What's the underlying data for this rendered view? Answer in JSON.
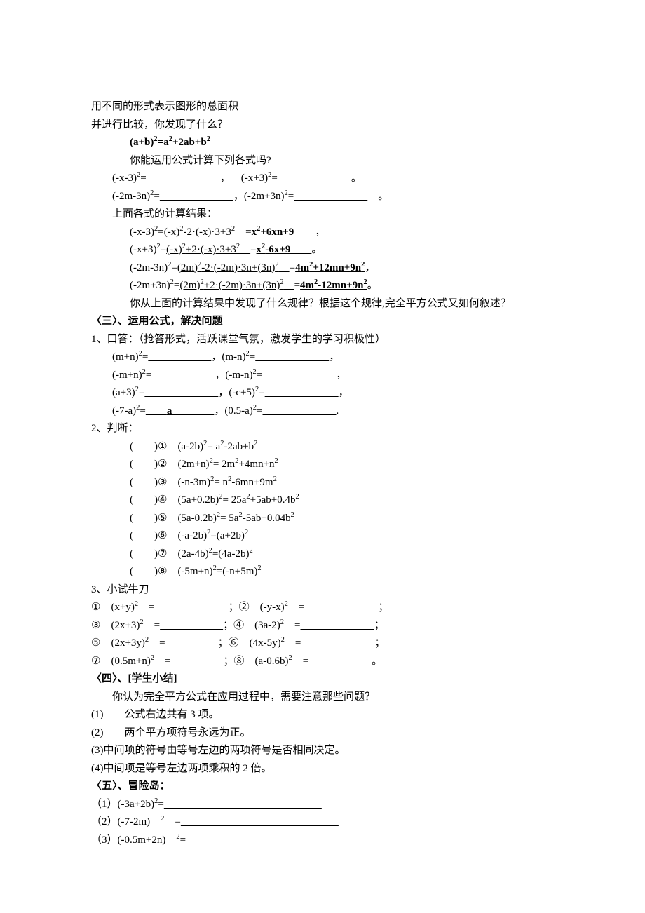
{
  "lines": [
    {
      "cls": "indent1",
      "html": "用不同的形式表示图形的总面积"
    },
    {
      "cls": "indent1",
      "html": "并进行比较，你发现了什么？"
    },
    {
      "cls": "indent2 bold",
      "html": "(a+b)<sup>2</sup>=a<sup>2</sup>+2ab+b<sup>2</sup>"
    },
    {
      "cls": "indent2",
      "html": "你能运用公式计算下列各式吗?"
    },
    {
      "cls": "indent3",
      "html": "(-x-3)<sup>2</sup>=<u>       </u>， (-x+3)<sup>2</sup>=<u>       </u>。"
    },
    {
      "cls": "indent3",
      "html": "(-2m-3n)<sup>2</sup>=<u>       </u>，(-2m+3n)<sup>2</sup>=<u>       </u> 。"
    },
    {
      "cls": "indent3",
      "html": "上面各式的计算结果："
    },
    {
      "cls": "indent2",
      "html": "(-x-3)<sup>2</sup>=<u>(-x)<sup>2</sup>-2·(-x)·3+3<sup>2</sup> </u>=<u class=\"bold\">x<sup>2</sup>+6xn+9  </u>，"
    },
    {
      "cls": "indent2",
      "html": "(-x+3)<sup>2</sup>=<u>(-x)<sup>2</sup>+2·(-x)·3+3<sup>2</sup> </u>=<u class=\"bold\">x<sup>2</sup>-6x+9  </u>。"
    },
    {
      "cls": "indent2",
      "html": "(-2m-3n)<sup>2</sup>=<u>(2m)<sup>2</sup>-2·(-2m)·3n+(3n)<sup>2</sup> </u>=<u class=\"bold\">4m<sup>2</sup>+12mn+9n<sup>2</sup></u>，"
    },
    {
      "cls": "indent2",
      "html": "(-2m+3n)<sup>2</sup>=<u>(2m)<sup>2</sup>+2·(-2m)·3n+(3n)<sup>2</sup> </u>=<u class=\"bold\">4m<sup>2</sup>-12mn+9n<sup>2</sup></u>。"
    },
    {
      "cls": "indent2",
      "html": "你从上面的计算结果中发现了什么规律？根据这个规律,完全平方公式又如何叙述？"
    },
    {
      "cls": "indent1 bold",
      "html": "〈三〉、运用公式，解决问题"
    },
    {
      "cls": "indent1",
      "html": "1、口答：（抢答形式，活跃课堂气氛，激发学生的学习积极性）"
    },
    {
      "cls": "indent3",
      "html": "(m+n)<sup>2</sup>=<u>      </u>，(m-n)<sup>2</sup>=<u>       </u>，"
    },
    {
      "cls": "indent3",
      "html": "(-m+n)<sup>2</sup>=<u>      </u>，(-m-n)<sup>2</sup>=<u>       </u>，"
    },
    {
      "cls": "indent3",
      "html": "(a+3)<sup>2</sup>=<u>       </u>，(-c+5)<sup>2</sup>=<u>       </u>，"
    },
    {
      "cls": "indent3",
      "html": "(-7-a)<sup>2</sup>=<u>  <span class=\"bold\">a</span>    </u>，(0.5-a)<sup>2</sup>=<u>       </u>."
    },
    {
      "cls": "indent1",
      "html": "2、判断："
    },
    {
      "cls": "indent2",
      "html": "(  )① (a-2b)<sup>2</sup>= a<sup>2</sup>-2ab+b<sup>2</sup>"
    },
    {
      "cls": "indent2",
      "html": "(  )② (2m+n)<sup>2</sup>= 2m<sup>2</sup>+4mn+n<sup>2</sup>"
    },
    {
      "cls": "indent2",
      "html": "(  )③ (-n-3m)<sup>2</sup>= n<sup>2</sup>-6mn+9m<sup>2</sup>"
    },
    {
      "cls": "indent2",
      "html": "(  )④ (5a+0.2b)<sup>2</sup>= 25a<sup>2</sup>+5ab+0.4b<sup>2</sup>"
    },
    {
      "cls": "indent2",
      "html": "(  )⑤ (5a-0.2b)<sup>2</sup>= 5a<sup>2</sup>-5ab+0.04b<sup>2</sup>"
    },
    {
      "cls": "indent2",
      "html": "(  )⑥ (-a-2b)<sup>2</sup>=(a+2b)<sup>2</sup>"
    },
    {
      "cls": "indent2",
      "html": "(  )⑦ (2a-4b)<sup>2</sup>=(4a-2b)<sup>2</sup>"
    },
    {
      "cls": "indent2",
      "html": "(  )⑧ (-5m+n)<sup>2</sup>=(-n+5m)<sup>2</sup>"
    },
    {
      "cls": "indent1",
      "html": "3、小试牛刀"
    },
    {
      "cls": "indent1",
      "html": "① (x+y)<sup>2</sup> =<u>       </u>；② (-y-x)<sup>2</sup> =<u>       </u>；"
    },
    {
      "cls": "indent1",
      "html": "③ (2x+3)<sup>2</sup> =<u>      </u>；④ (3a-2)<sup>2</sup> =<u>       </u>；"
    },
    {
      "cls": "indent1",
      "html": "⑤ (2x+3y)<sup>2</sup> =<u>     </u>；⑥ (4x-5y)<sup>2</sup> =<u>       </u>；"
    },
    {
      "cls": "indent1",
      "html": "⑦ (0.5m+n)<sup>2</sup> =<u>     </u>；⑧ (a-0.6b)<sup>2</sup> =<u>      </u>。"
    },
    {
      "cls": "indent1 bold",
      "html": "〈四〉、[学生小结]"
    },
    {
      "cls": "indent3",
      "html": "你认为完全平方公式在应用过程中，需要注意那些问题？"
    },
    {
      "cls": "indent1",
      "html": "(1)  公式右边共有 3 项。"
    },
    {
      "cls": "indent1",
      "html": "(2)  两个平方项符号永远为正。"
    },
    {
      "cls": "indent1",
      "html": "(3)中间项的符号由等号左边的两项符号是否相同决定。"
    },
    {
      "cls": "indent1",
      "html": "(4)中间项是等号左边两项乘积的 2 倍。"
    },
    {
      "cls": "indent1 bold",
      "html": "〈五〉、冒险岛："
    },
    {
      "cls": "indent1",
      "html": "（1）(-3a+2b)<sup>2</sup>=<u>               </u>"
    },
    {
      "cls": "indent1",
      "html": "（2）(-7-2m) <sup>2</sup> =<u>               </u>"
    },
    {
      "cls": "indent1",
      "html": "（3）(-0.5m+2n) <sup>2</sup>=<u>               </u>"
    }
  ]
}
